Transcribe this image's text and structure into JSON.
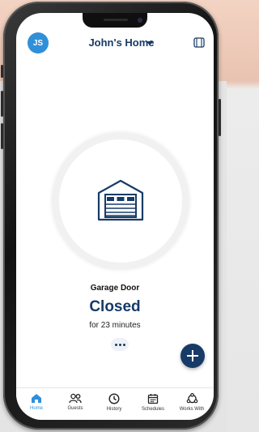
{
  "header": {
    "avatar_initials": "JS",
    "home_name": "John's Home"
  },
  "device": {
    "name": "Garage Door",
    "status": "Closed",
    "duration": "for 23 minutes"
  },
  "tabs": [
    {
      "label": "Home",
      "icon": "home-icon",
      "active": true
    },
    {
      "label": "Guests",
      "icon": "guests-icon",
      "active": false
    },
    {
      "label": "History",
      "icon": "clock-icon",
      "active": false
    },
    {
      "label": "Schedules",
      "icon": "calendar-icon",
      "active": false
    },
    {
      "label": "Works With",
      "icon": "works-with-icon",
      "active": false
    }
  ],
  "colors": {
    "brand_navy": "#173b66",
    "accent_blue": "#2f8fd8"
  }
}
